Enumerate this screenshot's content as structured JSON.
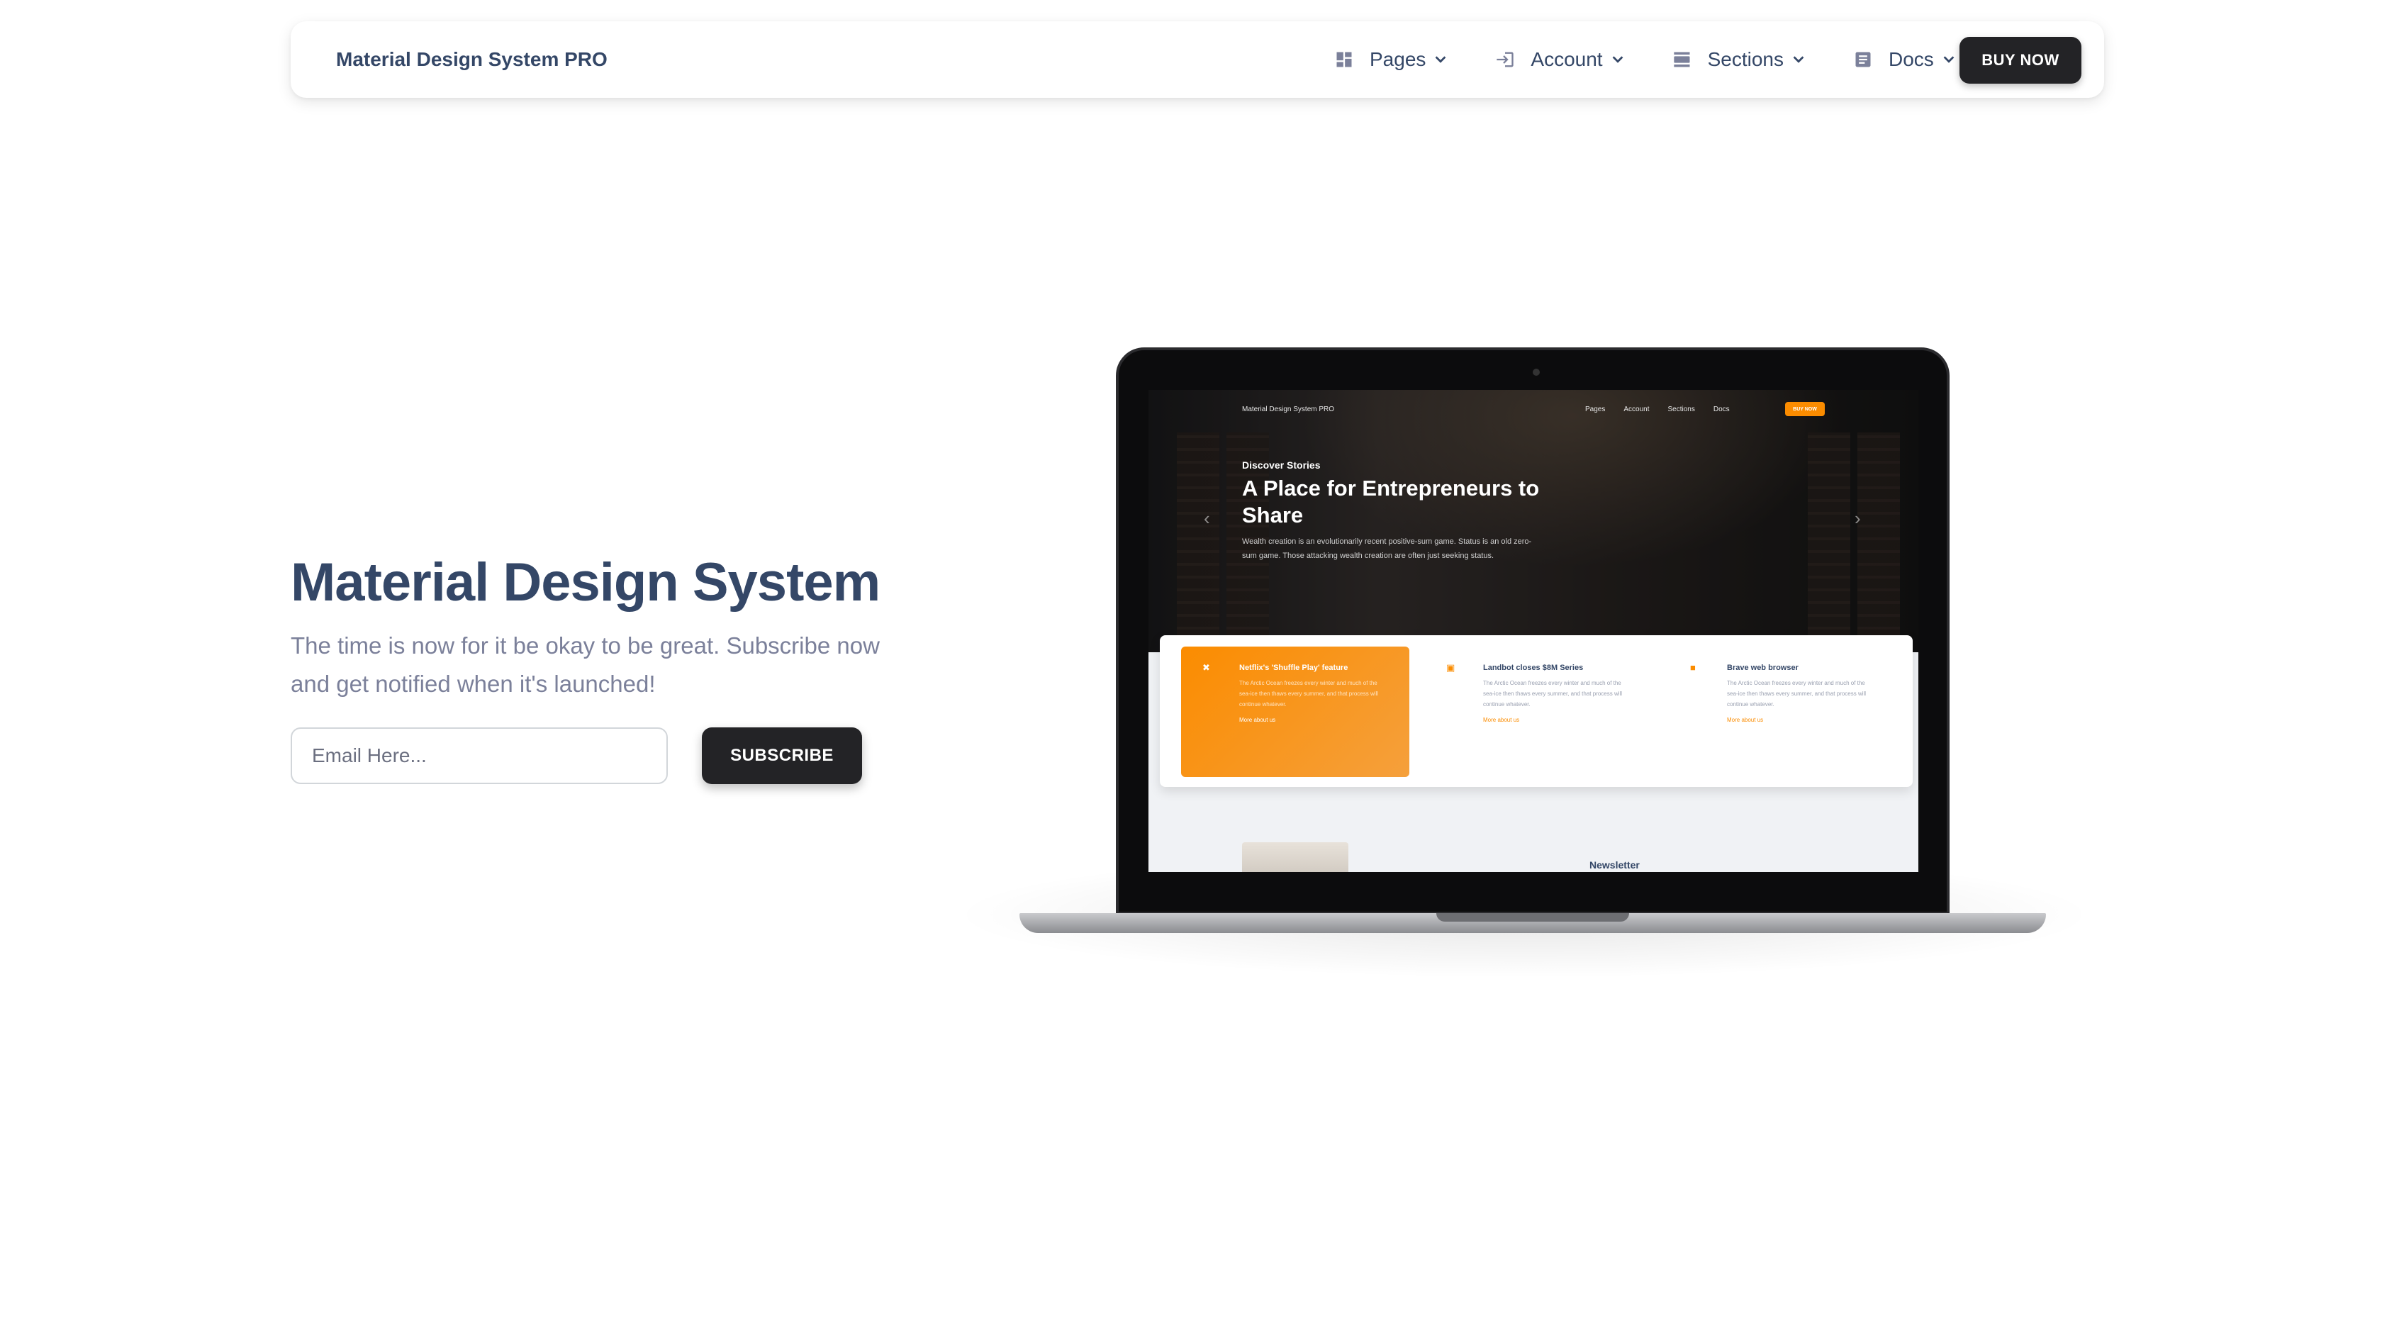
{
  "navbar": {
    "brand": "Material Design System PRO",
    "items": [
      {
        "label": "Pages",
        "icon": "dashboard-grid-icon"
      },
      {
        "label": "Account",
        "icon": "login-icon"
      },
      {
        "label": "Sections",
        "icon": "view-day-icon"
      },
      {
        "label": "Docs",
        "icon": "article-icon"
      }
    ],
    "buy_label": "BUY NOW"
  },
  "hero": {
    "title": "Material Design System",
    "subtitle": "The time is now for it be okay to be great. Subscribe now and get notified when it's launched!",
    "email_placeholder": "Email Here...",
    "subscribe_label": "SUBSCRIBE"
  },
  "preview": {
    "brand": "Material Design System PRO",
    "links": [
      "Pages",
      "Account",
      "Sections",
      "Docs"
    ],
    "buy_label": "BUY NOW",
    "eyebrow": "Discover Stories",
    "title": "A Place for Entrepreneurs to Share",
    "description": "Wealth creation is an evolutionarily recent positive-sum game. Status is an old zero-sum game. Those attacking wealth creation are often just seeking status.",
    "cards": [
      {
        "title": "Netflix's 'Shuffle Play' feature",
        "text": "The Arctic Ocean freezes every winter and much of the sea-ice then thaws every summer, and that process will continue whatever.",
        "link": "More about us"
      },
      {
        "title": "Landbot closes $8M Series",
        "text": "The Arctic Ocean freezes every winter and much of the sea-ice then thaws every summer, and that process will continue whatever.",
        "link": "More about us"
      },
      {
        "title": "Brave web browser",
        "text": "The Arctic Ocean freezes every winter and much of the sea-ice then thaws every summer, and that process will continue whatever.",
        "link": "More about us"
      }
    ],
    "newsletter": "Newsletter"
  },
  "colors": {
    "text_dark": "#344767",
    "text_muted": "#7b809a",
    "button_dark": "#232326",
    "accent_orange": "#fb8c00"
  }
}
